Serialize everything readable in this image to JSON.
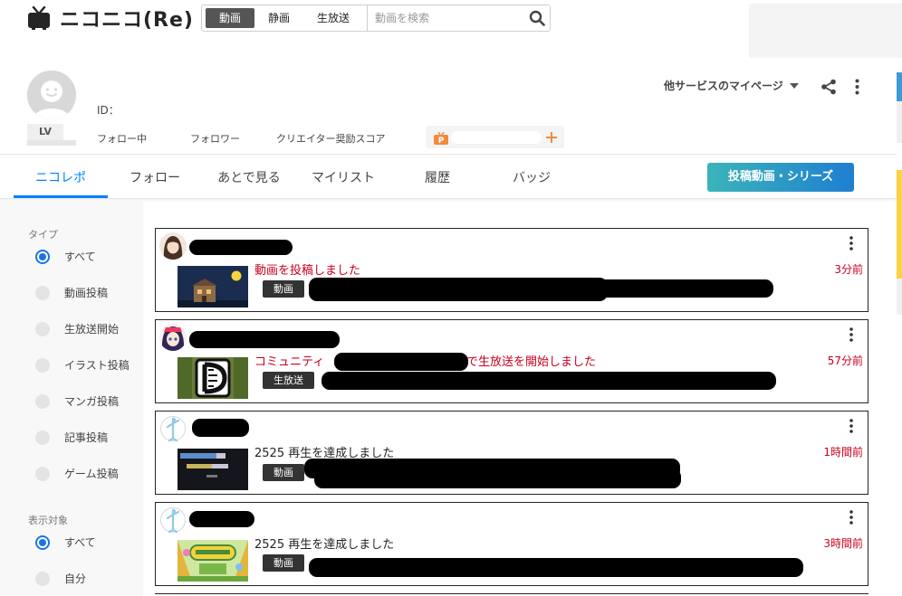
{
  "header": {
    "logo_text": "ニコニコ(Re)",
    "search": {
      "segments": [
        {
          "label": "動画",
          "active": true
        },
        {
          "label": "静画",
          "active": false
        },
        {
          "label": "生放送",
          "active": false
        }
      ],
      "placeholder": "動画を検索"
    }
  },
  "profile": {
    "lv_label": "LV",
    "id_label": "ID：",
    "following_label": "フォロー中",
    "followers_label": "フォロワー",
    "creator_score_label": "クリエイター奨励スコア",
    "other_services_label": "他サービスのマイページ"
  },
  "tabs": [
    {
      "label": "ニコレポ",
      "active": true
    },
    {
      "label": "フォロー",
      "active": false
    },
    {
      "label": "あとで見る",
      "active": false
    },
    {
      "label": "マイリスト",
      "active": false
    },
    {
      "label": "履歴",
      "active": false
    },
    {
      "label": "バッジ",
      "active": false
    }
  ],
  "upload_button": "投稿動画・シリーズ",
  "sidebar": {
    "type_heading": "タイプ",
    "type_options": [
      {
        "label": "すべて",
        "selected": true
      },
      {
        "label": "動画投稿",
        "selected": false
      },
      {
        "label": "生放送開始",
        "selected": false
      },
      {
        "label": "イラスト投稿",
        "selected": false
      },
      {
        "label": "マンガ投稿",
        "selected": false
      },
      {
        "label": "記事投稿",
        "selected": false
      },
      {
        "label": "ゲーム投稿",
        "selected": false
      }
    ],
    "target_heading": "表示対象",
    "target_options": [
      {
        "label": "すべて",
        "selected": true
      },
      {
        "label": "自分",
        "selected": false
      }
    ]
  },
  "feed": [
    {
      "message": "動画を投稿しました",
      "time": "3分前",
      "badge": "動画",
      "message_color": "red"
    },
    {
      "message_prefix": "コミュニティ",
      "message": "で生放送を開始しました",
      "time": "57分前",
      "badge": "生放送",
      "message_color": "red"
    },
    {
      "message": "2525 再生を達成しました",
      "time": "1時間前",
      "badge": "動画",
      "message_color": "dark"
    },
    {
      "message": "2525 再生を達成しました",
      "time": "3時間前",
      "badge": "動画",
      "message_color": "dark"
    }
  ],
  "colors": {
    "accent": "#0080ff",
    "feed_red": "#c8001e",
    "upload_gradient_start": "#3bb4b8",
    "upload_gradient_end": "#1f7fd1"
  }
}
